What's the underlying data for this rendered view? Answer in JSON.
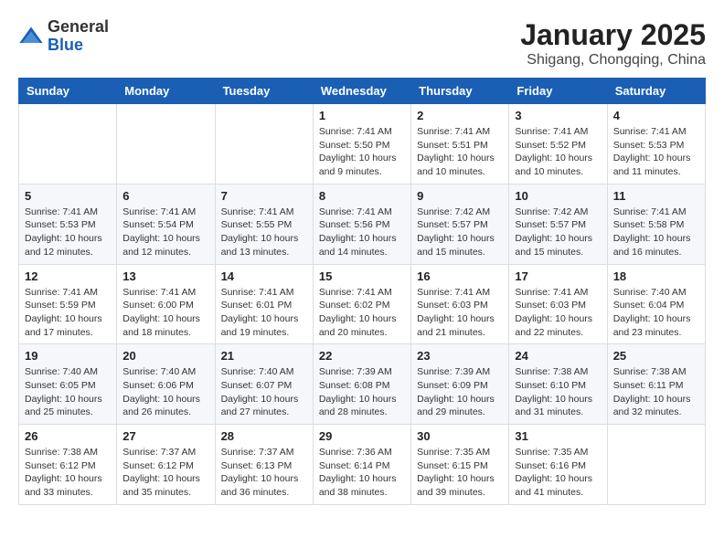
{
  "header": {
    "logo_line1": "General",
    "logo_line2": "Blue",
    "month": "January 2025",
    "location": "Shigang, Chongqing, China"
  },
  "weekdays": [
    "Sunday",
    "Monday",
    "Tuesday",
    "Wednesday",
    "Thursday",
    "Friday",
    "Saturday"
  ],
  "weeks": [
    [
      {
        "day": "",
        "info": ""
      },
      {
        "day": "",
        "info": ""
      },
      {
        "day": "",
        "info": ""
      },
      {
        "day": "1",
        "info": "Sunrise: 7:41 AM\nSunset: 5:50 PM\nDaylight: 10 hours\nand 9 minutes."
      },
      {
        "day": "2",
        "info": "Sunrise: 7:41 AM\nSunset: 5:51 PM\nDaylight: 10 hours\nand 10 minutes."
      },
      {
        "day": "3",
        "info": "Sunrise: 7:41 AM\nSunset: 5:52 PM\nDaylight: 10 hours\nand 10 minutes."
      },
      {
        "day": "4",
        "info": "Sunrise: 7:41 AM\nSunset: 5:53 PM\nDaylight: 10 hours\nand 11 minutes."
      }
    ],
    [
      {
        "day": "5",
        "info": "Sunrise: 7:41 AM\nSunset: 5:53 PM\nDaylight: 10 hours\nand 12 minutes."
      },
      {
        "day": "6",
        "info": "Sunrise: 7:41 AM\nSunset: 5:54 PM\nDaylight: 10 hours\nand 12 minutes."
      },
      {
        "day": "7",
        "info": "Sunrise: 7:41 AM\nSunset: 5:55 PM\nDaylight: 10 hours\nand 13 minutes."
      },
      {
        "day": "8",
        "info": "Sunrise: 7:41 AM\nSunset: 5:56 PM\nDaylight: 10 hours\nand 14 minutes."
      },
      {
        "day": "9",
        "info": "Sunrise: 7:42 AM\nSunset: 5:57 PM\nDaylight: 10 hours\nand 15 minutes."
      },
      {
        "day": "10",
        "info": "Sunrise: 7:42 AM\nSunset: 5:57 PM\nDaylight: 10 hours\nand 15 minutes."
      },
      {
        "day": "11",
        "info": "Sunrise: 7:41 AM\nSunset: 5:58 PM\nDaylight: 10 hours\nand 16 minutes."
      }
    ],
    [
      {
        "day": "12",
        "info": "Sunrise: 7:41 AM\nSunset: 5:59 PM\nDaylight: 10 hours\nand 17 minutes."
      },
      {
        "day": "13",
        "info": "Sunrise: 7:41 AM\nSunset: 6:00 PM\nDaylight: 10 hours\nand 18 minutes."
      },
      {
        "day": "14",
        "info": "Sunrise: 7:41 AM\nSunset: 6:01 PM\nDaylight: 10 hours\nand 19 minutes."
      },
      {
        "day": "15",
        "info": "Sunrise: 7:41 AM\nSunset: 6:02 PM\nDaylight: 10 hours\nand 20 minutes."
      },
      {
        "day": "16",
        "info": "Sunrise: 7:41 AM\nSunset: 6:03 PM\nDaylight: 10 hours\nand 21 minutes."
      },
      {
        "day": "17",
        "info": "Sunrise: 7:41 AM\nSunset: 6:03 PM\nDaylight: 10 hours\nand 22 minutes."
      },
      {
        "day": "18",
        "info": "Sunrise: 7:40 AM\nSunset: 6:04 PM\nDaylight: 10 hours\nand 23 minutes."
      }
    ],
    [
      {
        "day": "19",
        "info": "Sunrise: 7:40 AM\nSunset: 6:05 PM\nDaylight: 10 hours\nand 25 minutes."
      },
      {
        "day": "20",
        "info": "Sunrise: 7:40 AM\nSunset: 6:06 PM\nDaylight: 10 hours\nand 26 minutes."
      },
      {
        "day": "21",
        "info": "Sunrise: 7:40 AM\nSunset: 6:07 PM\nDaylight: 10 hours\nand 27 minutes."
      },
      {
        "day": "22",
        "info": "Sunrise: 7:39 AM\nSunset: 6:08 PM\nDaylight: 10 hours\nand 28 minutes."
      },
      {
        "day": "23",
        "info": "Sunrise: 7:39 AM\nSunset: 6:09 PM\nDaylight: 10 hours\nand 29 minutes."
      },
      {
        "day": "24",
        "info": "Sunrise: 7:38 AM\nSunset: 6:10 PM\nDaylight: 10 hours\nand 31 minutes."
      },
      {
        "day": "25",
        "info": "Sunrise: 7:38 AM\nSunset: 6:11 PM\nDaylight: 10 hours\nand 32 minutes."
      }
    ],
    [
      {
        "day": "26",
        "info": "Sunrise: 7:38 AM\nSunset: 6:12 PM\nDaylight: 10 hours\nand 33 minutes."
      },
      {
        "day": "27",
        "info": "Sunrise: 7:37 AM\nSunset: 6:12 PM\nDaylight: 10 hours\nand 35 minutes."
      },
      {
        "day": "28",
        "info": "Sunrise: 7:37 AM\nSunset: 6:13 PM\nDaylight: 10 hours\nand 36 minutes."
      },
      {
        "day": "29",
        "info": "Sunrise: 7:36 AM\nSunset: 6:14 PM\nDaylight: 10 hours\nand 38 minutes."
      },
      {
        "day": "30",
        "info": "Sunrise: 7:35 AM\nSunset: 6:15 PM\nDaylight: 10 hours\nand 39 minutes."
      },
      {
        "day": "31",
        "info": "Sunrise: 7:35 AM\nSunset: 6:16 PM\nDaylight: 10 hours\nand 41 minutes."
      },
      {
        "day": "",
        "info": ""
      }
    ]
  ]
}
